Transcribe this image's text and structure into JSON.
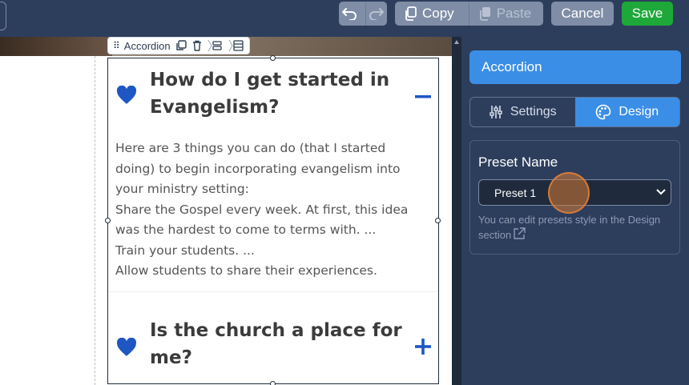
{
  "toolbar": {
    "copy_label": "Copy",
    "paste_label": "Paste",
    "cancel_label": "Cancel",
    "save_label": "Save"
  },
  "element_toolbar": {
    "label": "Accordion"
  },
  "accordion": {
    "items": [
      {
        "title": "How do I get started in Evangelism?",
        "expanded": true,
        "body": [
          "Here are 3 things you can do (that I started",
          "doing) to begin incorporating evangelism into",
          "your ministry setting:",
          "Share the Gospel every week. At first, this idea",
          "was the hardest to come to terms with. ...",
          "Train your students. ...",
          "Allow students to share their experiences."
        ]
      },
      {
        "title": "Is the church a place for me?",
        "expanded": false
      }
    ],
    "heart_color": "#1e56c4",
    "toggle_color": "#1e56c4"
  },
  "panel": {
    "title": "Accordion",
    "tabs": [
      {
        "label": "Settings",
        "icon": "sliders-icon",
        "active": false
      },
      {
        "label": "Design",
        "icon": "palette-icon",
        "active": true
      }
    ],
    "preset": {
      "label": "Preset Name",
      "selected": "Preset 1",
      "hint": "You can edit presets style in the Design section"
    }
  },
  "colors": {
    "topbar": "#2d3e5c",
    "accent": "#3b8ee6",
    "save": "#1ea83a"
  }
}
